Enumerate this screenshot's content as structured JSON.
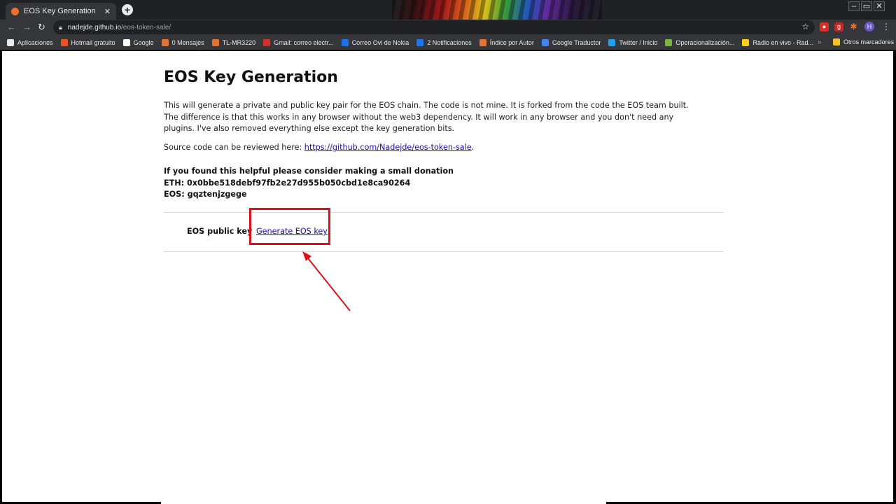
{
  "browser": {
    "tab_title": "EOS Key Generation",
    "tab_close": "✕",
    "new_tab": "+",
    "url_host": "nadejde.github.io",
    "url_path": "/eos-token-sale/",
    "profile_initial": "H",
    "window_controls": [
      "–",
      "▭",
      "✕"
    ],
    "bookmarks": [
      {
        "label": "Aplicaciones",
        "icon": "apps-grid-icon",
        "color": "#e8eaed"
      },
      {
        "label": "Hotmail gratuito",
        "icon": "windows-logo-icon",
        "color": "#f25022"
      },
      {
        "label": "Google",
        "icon": "google-g-icon",
        "color": "#ffffff"
      },
      {
        "label": "0 Mensajes",
        "icon": "globe-icon",
        "color": "#e8732e"
      },
      {
        "label": "TL-MR3220",
        "icon": "globe-icon",
        "color": "#e8732e"
      },
      {
        "label": "Gmail: correo electr...",
        "icon": "gmail-icon",
        "color": "#d93025"
      },
      {
        "label": "Correo Ovi de Nokia",
        "icon": "ovi-icon",
        "color": "#1a73e8"
      },
      {
        "label": "2 Notificaciones",
        "icon": "facebook-icon",
        "color": "#1877f2"
      },
      {
        "label": "Índice por Autor",
        "icon": "globe-icon",
        "color": "#e8732e"
      },
      {
        "label": "Google Traductor",
        "icon": "translate-icon",
        "color": "#4285f4"
      },
      {
        "label": "Twitter / Inicio",
        "icon": "twitter-icon",
        "color": "#1da1f2"
      },
      {
        "label": "Operacionalización...",
        "icon": "doc-icon",
        "color": "#7cb342"
      },
      {
        "label": "Radio en vivo - Rad...",
        "icon": "flag-icon",
        "color": "#fcd116"
      }
    ],
    "bookmarks_more": "»",
    "other_bookmarks": "Otros marcadores"
  },
  "page": {
    "title": "EOS Key Generation",
    "intro": "This will generate a private and public key pair for the EOS chain. The code is not mine. It is forked from the code the EOS team built. The difference is that this works in any browser without the web3 dependency. It will work in any browser and you don't need any plugins. I've also removed everything else except the key generation bits.",
    "source_prefix": "Source code can be reviewed here: ",
    "source_link": "https://github.com/Nadejde/eos-token-sale",
    "source_suffix": ".",
    "donation_line": "If you found this helpful please consider making a small donation",
    "eth_line": "ETH: 0x0bbe518debf97fb2e27d955b050cbd1e8ca90264",
    "eos_line": "EOS: gqztenjzgege",
    "key_label": "EOS public key",
    "generate_link": "Generate EOS key"
  },
  "annotation": {
    "highlight_color": "#e0101a"
  }
}
